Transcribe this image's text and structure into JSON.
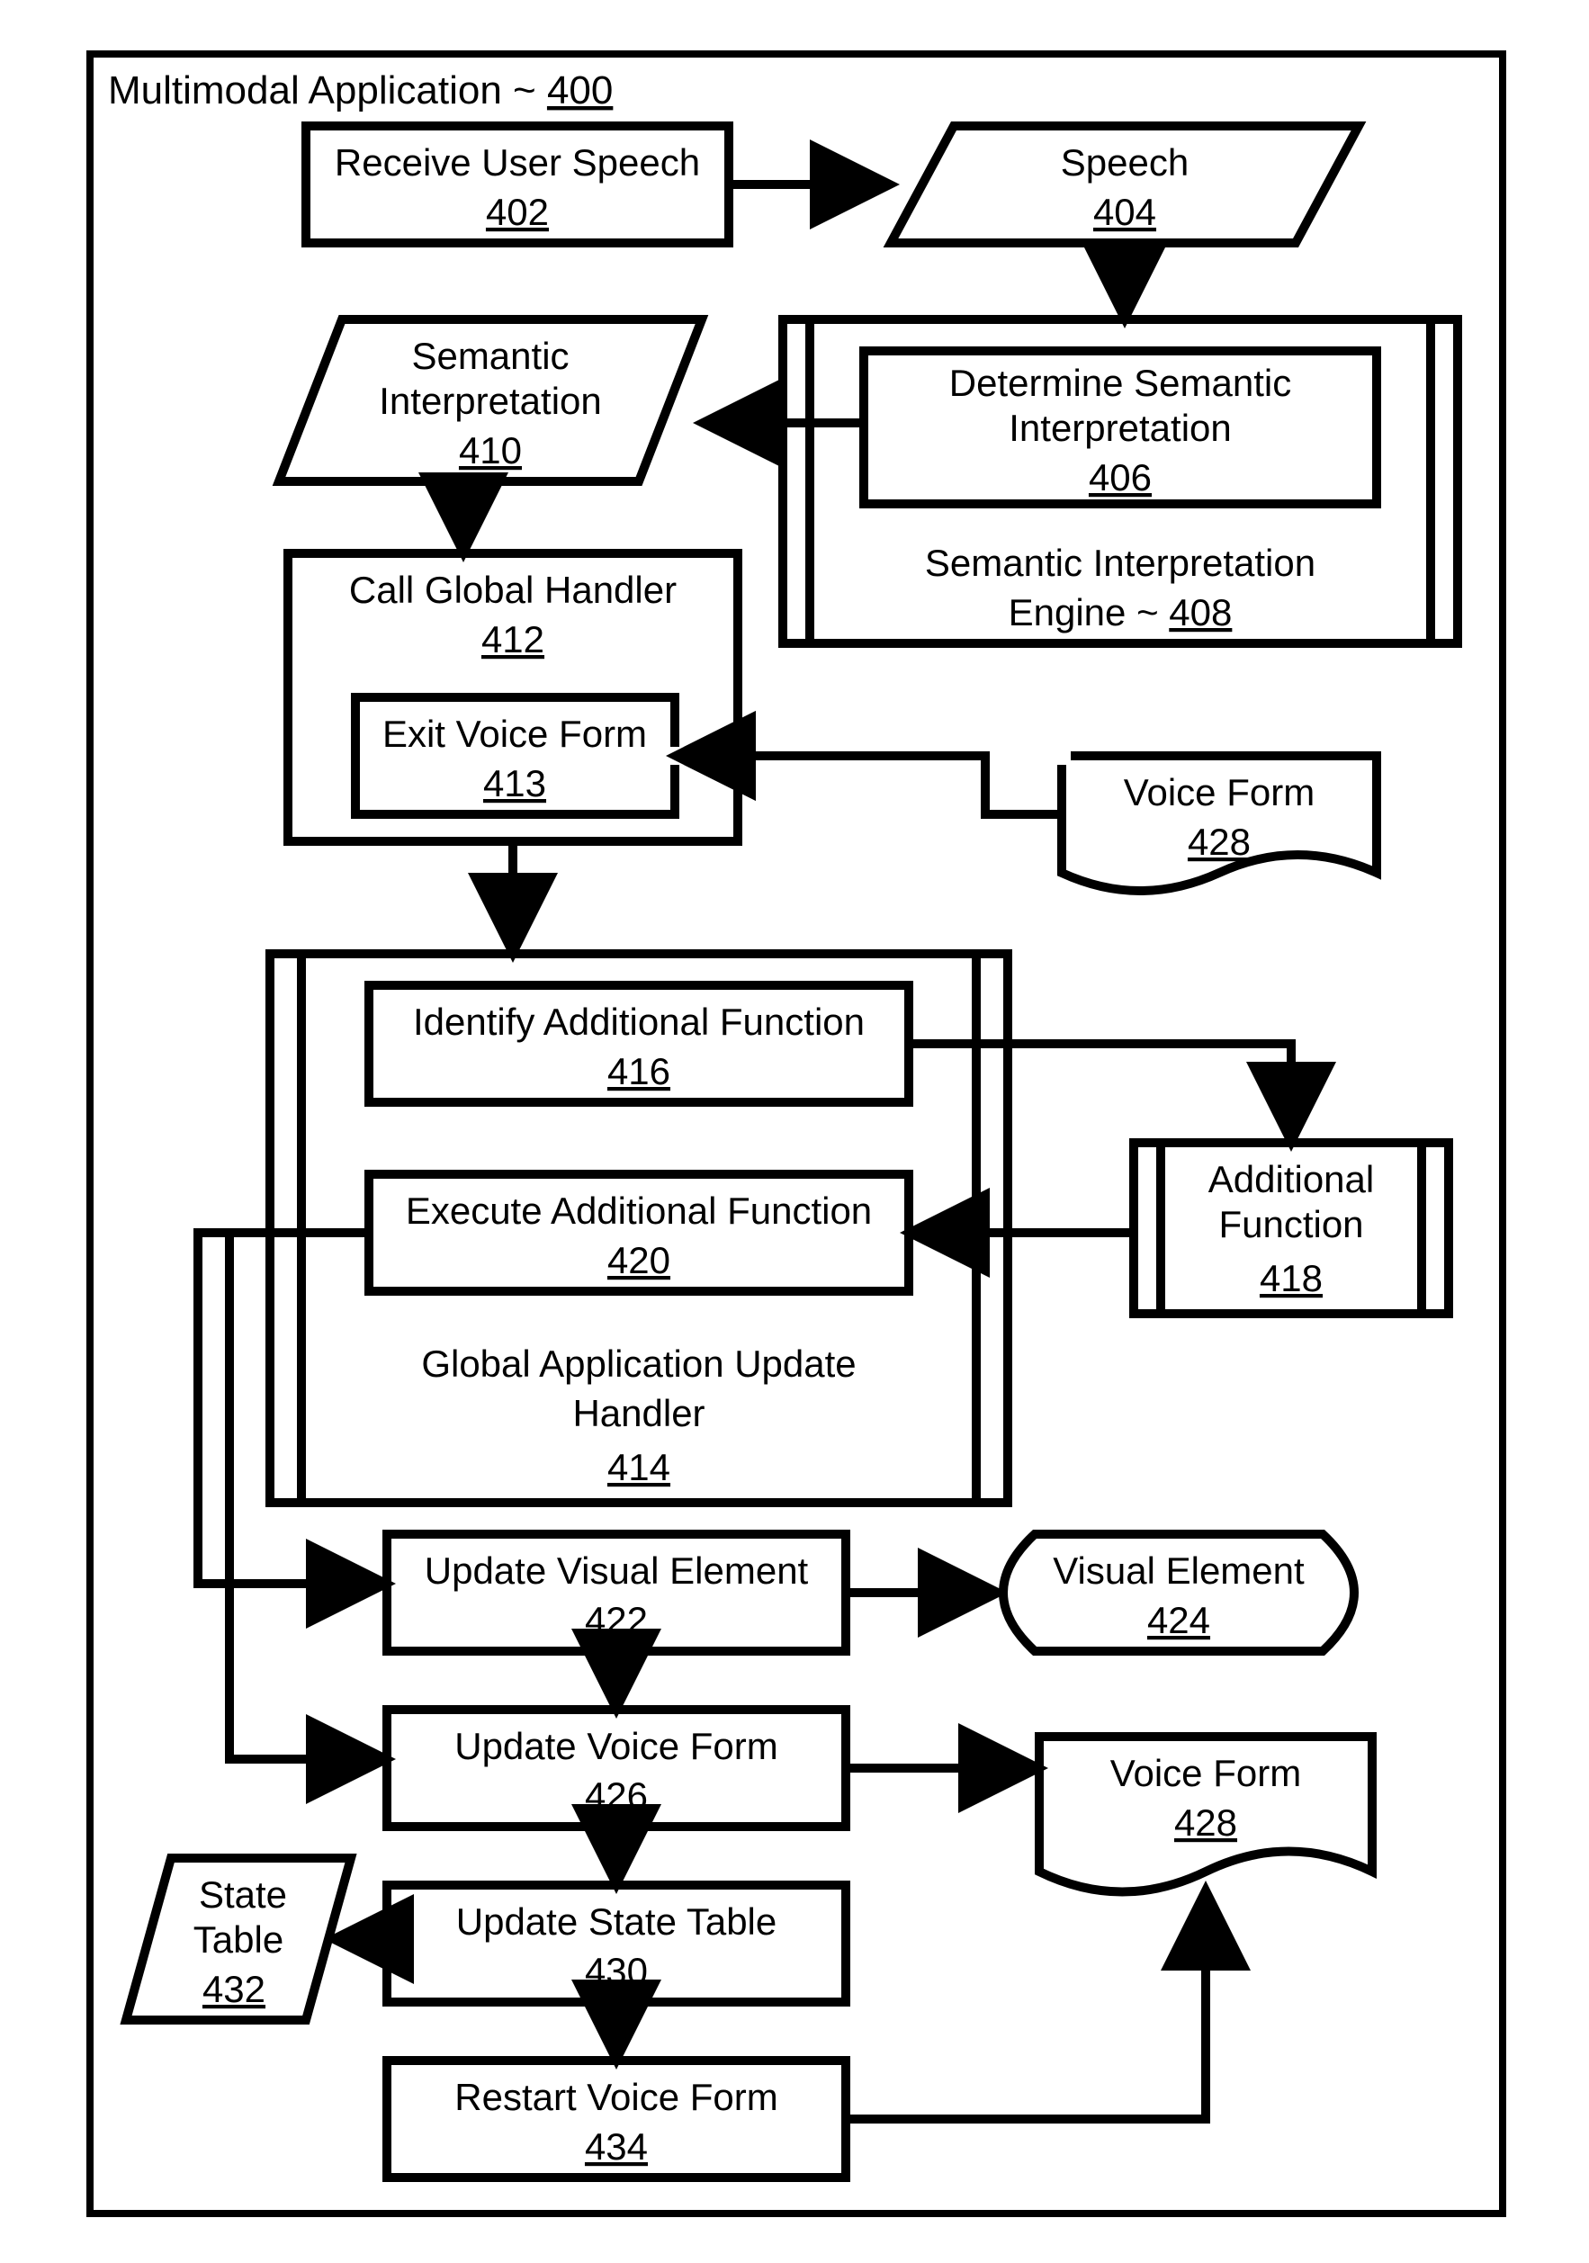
{
  "title_text": "Multimodal Application ~ ",
  "title_ref": "400",
  "n402_l1": "Receive User Speech",
  "n402_ref": "402",
  "n404_l1": "Speech",
  "n404_ref": "404",
  "n406_l1": "Determine Semantic",
  "n406_l2": "Interpretation",
  "n406_ref": "406",
  "n408_l1": "Semantic Interpretation",
  "n408_l2": "Engine ~ ",
  "n408_ref": "408",
  "n410_l1": "Semantic",
  "n410_l2": "Interpretation",
  "n410_ref": "410",
  "n412_l1": "Call Global Handler",
  "n412_ref": "412",
  "n413_l1": "Exit Voice Form",
  "n413_ref": "413",
  "n414_l1": "Global Application Update",
  "n414_l2": "Handler",
  "n414_ref": "414",
  "n416_l1": "Identify Additional Function",
  "n416_ref": "416",
  "n418_l1": "Additional",
  "n418_l2": "Function",
  "n418_ref": "418",
  "n420_l1": "Execute Additional Function",
  "n420_ref": "420",
  "n422_l1": "Update Visual Element",
  "n422_ref": "422",
  "n424_l1": "Visual Element",
  "n424_ref": "424",
  "n426_l1": "Update Voice Form",
  "n426_ref": "426",
  "n428_l1": "Voice Form",
  "n428_ref": "428",
  "n430_l1": "Update State Table",
  "n430_ref": "430",
  "n432_l1": "State",
  "n432_l2": "Table",
  "n432_ref": "432",
  "n434_l1": "Restart Voice Form",
  "n434_ref": "434",
  "chart_data": {
    "type": "diagram",
    "title": "Multimodal Application flowchart (ref 400)",
    "nodes": [
      {
        "id": "400",
        "label": "Multimodal Application",
        "shape": "container"
      },
      {
        "id": "402",
        "label": "Receive User Speech",
        "shape": "process"
      },
      {
        "id": "404",
        "label": "Speech",
        "shape": "data"
      },
      {
        "id": "406",
        "label": "Determine Semantic Interpretation",
        "shape": "process"
      },
      {
        "id": "408",
        "label": "Semantic Interpretation Engine",
        "shape": "subroutine-container",
        "contains": [
          "406"
        ]
      },
      {
        "id": "410",
        "label": "Semantic Interpretation",
        "shape": "data"
      },
      {
        "id": "412",
        "label": "Call Global Handler",
        "shape": "process-container",
        "contains": [
          "413"
        ]
      },
      {
        "id": "413",
        "label": "Exit Voice Form",
        "shape": "process"
      },
      {
        "id": "414",
        "label": "Global Application Update Handler",
        "shape": "subroutine-container",
        "contains": [
          "416",
          "420"
        ]
      },
      {
        "id": "416",
        "label": "Identify Additional Function",
        "shape": "process"
      },
      {
        "id": "418",
        "label": "Additional Function",
        "shape": "subroutine"
      },
      {
        "id": "420",
        "label": "Execute Additional Function",
        "shape": "process"
      },
      {
        "id": "422",
        "label": "Update Visual Element",
        "shape": "process"
      },
      {
        "id": "424",
        "label": "Visual Element",
        "shape": "display"
      },
      {
        "id": "426",
        "label": "Update Voice Form",
        "shape": "process"
      },
      {
        "id": "428",
        "label": "Voice Form",
        "shape": "document"
      },
      {
        "id": "430",
        "label": "Update State Table",
        "shape": "process"
      },
      {
        "id": "432",
        "label": "State Table",
        "shape": "data"
      },
      {
        "id": "434",
        "label": "Restart Voice Form",
        "shape": "process"
      }
    ],
    "edges": [
      {
        "from": "402",
        "to": "404"
      },
      {
        "from": "404",
        "to": "408"
      },
      {
        "from": "406",
        "to": "410"
      },
      {
        "from": "410",
        "to": "412"
      },
      {
        "from": "428",
        "to": "413",
        "note": "top 428 instance"
      },
      {
        "from": "412",
        "to": "414"
      },
      {
        "from": "416",
        "to": "418"
      },
      {
        "from": "418",
        "to": "420"
      },
      {
        "from": "420",
        "to": "422",
        "note": "via 414 left edge"
      },
      {
        "from": "420",
        "to": "426",
        "note": "via 414 left edge"
      },
      {
        "from": "422",
        "to": "424"
      },
      {
        "from": "422",
        "to": "426"
      },
      {
        "from": "426",
        "to": "428",
        "note": "bottom 428 instance"
      },
      {
        "from": "426",
        "to": "430"
      },
      {
        "from": "430",
        "to": "432"
      },
      {
        "from": "430",
        "to": "434"
      },
      {
        "from": "434",
        "to": "428",
        "note": "bottom 428 instance"
      }
    ]
  }
}
